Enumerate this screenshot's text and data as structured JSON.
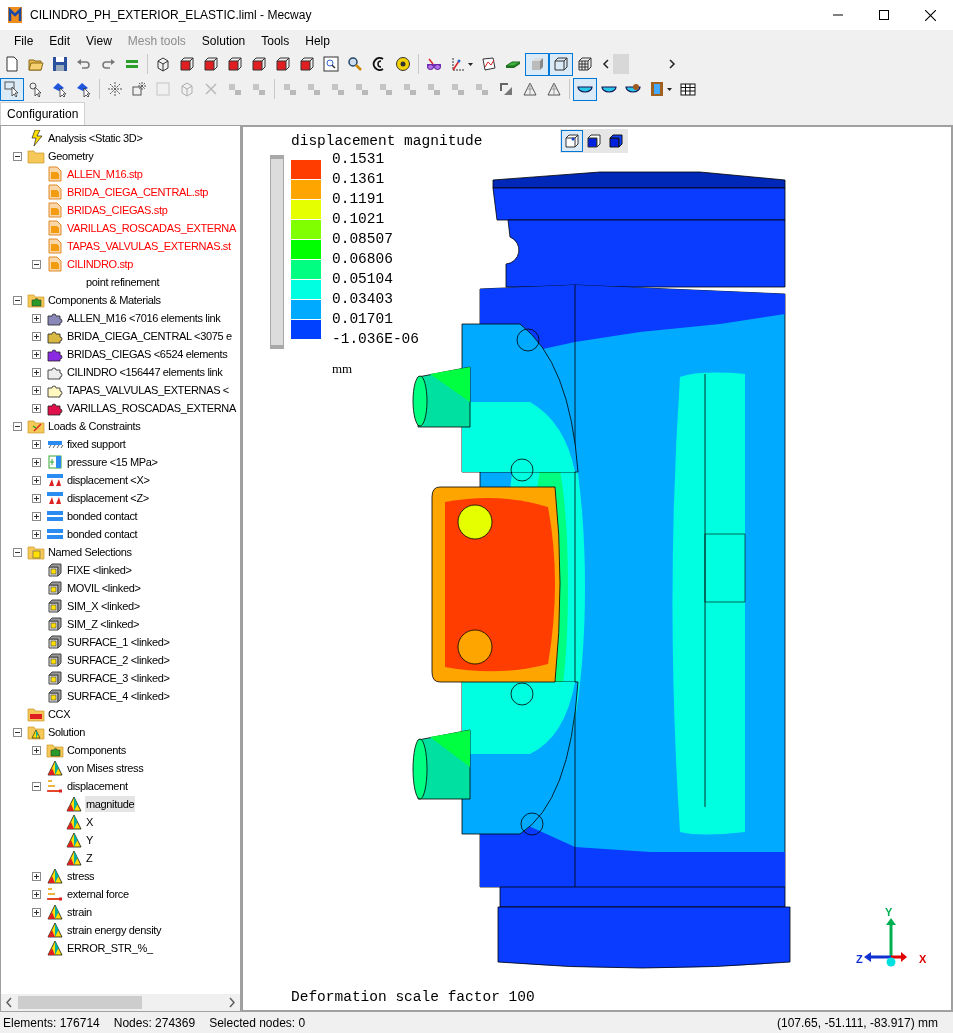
{
  "window": {
    "title": "CILINDRO_PH_EXTERIOR_ELASTIC.liml - Mecway"
  },
  "menu": [
    {
      "label": "File",
      "disabled": false
    },
    {
      "label": "Edit",
      "disabled": false
    },
    {
      "label": "View",
      "disabled": false
    },
    {
      "label": "Mesh tools",
      "disabled": true
    },
    {
      "label": "Solution",
      "disabled": false
    },
    {
      "label": "Tools",
      "disabled": false
    },
    {
      "label": "Help",
      "disabled": false
    }
  ],
  "toolbars": [
    [
      [
        {
          "kind": "page",
          "selected": false,
          "disabled": false,
          "dropdown": false
        },
        {
          "kind": "open",
          "selected": false,
          "disabled": false,
          "dropdown": false
        },
        {
          "kind": "save",
          "selected": false,
          "disabled": false,
          "dropdown": false
        },
        {
          "kind": "undo",
          "selected": false,
          "disabled": false,
          "dropdown": false
        },
        {
          "kind": "redo",
          "selected": false,
          "disabled": false,
          "dropdown": false
        },
        {
          "kind": "equals",
          "selected": false,
          "disabled": false,
          "dropdown": false
        }
      ],
      [
        {
          "kind": "wirecube",
          "selected": false,
          "disabled": false,
          "dropdown": false
        },
        {
          "kind": "redcube",
          "selected": false,
          "disabled": false,
          "dropdown": false
        },
        {
          "kind": "redcube",
          "selected": false,
          "disabled": false,
          "dropdown": false
        },
        {
          "kind": "redcube",
          "selected": false,
          "disabled": false,
          "dropdown": false
        },
        {
          "kind": "redcube",
          "selected": false,
          "disabled": false,
          "dropdown": false
        },
        {
          "kind": "redcube",
          "selected": false,
          "disabled": false,
          "dropdown": false
        },
        {
          "kind": "redcube",
          "selected": false,
          "disabled": false,
          "dropdown": false
        },
        {
          "kind": "zoombox",
          "selected": false,
          "disabled": false,
          "dropdown": false
        },
        {
          "kind": "magnifier",
          "selected": false,
          "disabled": false,
          "dropdown": false
        },
        {
          "kind": "rotate",
          "selected": false,
          "disabled": false,
          "dropdown": false
        },
        {
          "kind": "tape",
          "selected": false,
          "disabled": false,
          "dropdown": false
        }
      ],
      [
        {
          "kind": "glasses",
          "selected": false,
          "disabled": false,
          "dropdown": false
        },
        {
          "kind": "axes",
          "selected": false,
          "disabled": false,
          "dropdown": true
        },
        {
          "kind": "plot",
          "selected": false,
          "disabled": false,
          "dropdown": false
        },
        {
          "kind": "plate",
          "selected": false,
          "disabled": false,
          "dropdown": false
        },
        {
          "kind": "solidcube",
          "selected": true,
          "disabled": false,
          "dropdown": false
        },
        {
          "kind": "boxcube",
          "selected": true,
          "disabled": false,
          "dropdown": false
        },
        {
          "kind": "meshcube",
          "selected": false,
          "disabled": false,
          "dropdown": false
        }
      ]
    ],
    [
      [
        {
          "kind": "select",
          "selected": true,
          "disabled": false,
          "dropdown": false
        },
        {
          "kind": "selectpoint",
          "selected": false,
          "disabled": false,
          "dropdown": false
        },
        {
          "kind": "selectblue",
          "selected": false,
          "disabled": false,
          "dropdown": false
        },
        {
          "kind": "selectblue",
          "selected": false,
          "disabled": false,
          "dropdown": false
        }
      ],
      [
        {
          "kind": "star",
          "selected": false,
          "disabled": false,
          "dropdown": false
        },
        {
          "kind": "starbox",
          "selected": false,
          "disabled": false,
          "dropdown": false
        },
        {
          "kind": "square",
          "selected": false,
          "disabled": true,
          "dropdown": false
        },
        {
          "kind": "wirecube",
          "selected": false,
          "disabled": true,
          "dropdown": false
        },
        {
          "kind": "cross",
          "selected": false,
          "disabled": true,
          "dropdown": false
        },
        {
          "kind": "generic",
          "selected": false,
          "disabled": true,
          "dropdown": false
        },
        {
          "kind": "generic",
          "selected": false,
          "disabled": true,
          "dropdown": false
        }
      ],
      [
        {
          "kind": "generic",
          "selected": false,
          "disabled": true,
          "dropdown": false
        },
        {
          "kind": "generic",
          "selected": false,
          "disabled": true,
          "dropdown": false
        },
        {
          "kind": "generic",
          "selected": false,
          "disabled": true,
          "dropdown": false
        },
        {
          "kind": "generic",
          "selected": false,
          "disabled": true,
          "dropdown": false
        },
        {
          "kind": "generic",
          "selected": false,
          "disabled": true,
          "dropdown": false
        },
        {
          "kind": "generic",
          "selected": false,
          "disabled": true,
          "dropdown": false
        },
        {
          "kind": "generic",
          "selected": false,
          "disabled": true,
          "dropdown": false
        },
        {
          "kind": "generic",
          "selected": false,
          "disabled": true,
          "dropdown": false
        },
        {
          "kind": "generic",
          "selected": false,
          "disabled": true,
          "dropdown": false
        },
        {
          "kind": "corner",
          "selected": false,
          "disabled": false,
          "dropdown": false
        },
        {
          "kind": "triangle",
          "selected": false,
          "disabled": false,
          "dropdown": false
        },
        {
          "kind": "triangle",
          "selected": false,
          "disabled": false,
          "dropdown": false
        }
      ],
      [
        {
          "kind": "bowl",
          "selected": true,
          "disabled": false,
          "dropdown": false
        },
        {
          "kind": "bowl",
          "selected": false,
          "disabled": false,
          "dropdown": false
        },
        {
          "kind": "bowleye",
          "selected": false,
          "disabled": false,
          "dropdown": false
        },
        {
          "kind": "film",
          "selected": false,
          "disabled": false,
          "dropdown": true
        },
        {
          "kind": "table",
          "selected": false,
          "disabled": false,
          "dropdown": false
        }
      ]
    ]
  ],
  "tabs": [
    {
      "label": "Configuration",
      "selected": true
    }
  ],
  "tree": [
    {
      "label": "Analysis <Static 3D>",
      "kind": "analysis",
      "selected": false
    },
    {
      "label": "Geometry",
      "kind": "folder",
      "expanded": true,
      "selected": false,
      "children": [
        {
          "label": "ALLEN_M16.stp",
          "kind": "file",
          "color": "#ff0000",
          "selected": false
        },
        {
          "label": "BRIDA_CIEGA_CENTRAL.stp",
          "kind": "file",
          "color": "#ff0000",
          "selected": false
        },
        {
          "label": "BRIDAS_CIEGAS.stp",
          "kind": "file",
          "color": "#ff0000",
          "selected": false
        },
        {
          "label": "VARILLAS_ROSCADAS_EXTERNA",
          "kind": "file",
          "color": "#ff0000",
          "selected": false
        },
        {
          "label": "TAPAS_VALVULAS_EXTERNAS.st",
          "kind": "file",
          "color": "#ff0000",
          "selected": false
        },
        {
          "label": "CILINDRO.stp",
          "kind": "file",
          "color": "#ff0000",
          "expanded": true,
          "selected": false,
          "children": [
            {
              "label": "point refinement",
              "kind": "plain",
              "selected": false
            }
          ]
        }
      ]
    },
    {
      "label": "Components & Materials",
      "kind": "components-folder",
      "expanded": true,
      "selected": false,
      "children": [
        {
          "label": "ALLEN_M16 <7016 elements link",
          "kind": "component",
          "color": "#8a88b8",
          "expanded": false,
          "selected": false
        },
        {
          "label": "BRIDA_CIEGA_CENTRAL <3075 e",
          "kind": "component",
          "color": "#d8b840",
          "expanded": false,
          "selected": false
        },
        {
          "label": "BRIDAS_CIEGAS <6524 elements",
          "kind": "component",
          "color": "#8a2be2",
          "expanded": false,
          "selected": false
        },
        {
          "label": "CILINDRO <156447 elements link",
          "kind": "component",
          "color": "#ececec",
          "expanded": false,
          "selected": false
        },
        {
          "label": "TAPAS_VALVULAS_EXTERNAS <",
          "kind": "component",
          "color": "#fff8c0",
          "expanded": false,
          "selected": false
        },
        {
          "label": "VARILLAS_ROSCADAS_EXTERNA",
          "kind": "component",
          "color": "#e0104a",
          "expanded": false,
          "selected": false
        }
      ]
    },
    {
      "label": "Loads & Constraints",
      "kind": "loads-folder",
      "expanded": true,
      "selected": false,
      "children": [
        {
          "label": "fixed support",
          "kind": "fixed",
          "expanded": false,
          "selected": false
        },
        {
          "label": "pressure <15 MPa>",
          "kind": "pressure",
          "expanded": false,
          "selected": false
        },
        {
          "label": "displacement <X>",
          "kind": "displacement",
          "expanded": false,
          "selected": false
        },
        {
          "label": "displacement <Z>",
          "kind": "displacement",
          "expanded": false,
          "selected": false
        },
        {
          "label": "bonded contact",
          "kind": "bonded",
          "expanded": false,
          "selected": false
        },
        {
          "label": "bonded contact",
          "kind": "bonded",
          "expanded": false,
          "selected": false
        }
      ]
    },
    {
      "label": "Named Selections",
      "kind": "selections-folder",
      "expanded": true,
      "selected": false,
      "children": [
        {
          "label": "FIXE <linked>",
          "kind": "selection",
          "selected": false
        },
        {
          "label": "MOVIL <linked>",
          "kind": "selection",
          "selected": false
        },
        {
          "label": "SIM_X <linked>",
          "kind": "selection",
          "selected": false
        },
        {
          "label": "SIM_Z <linked>",
          "kind": "selection",
          "selected": false
        },
        {
          "label": "SURFACE_1 <linked>",
          "kind": "selection",
          "selected": false
        },
        {
          "label": "SURFACE_2 <linked>",
          "kind": "selection",
          "selected": false
        },
        {
          "label": "SURFACE_3 <linked>",
          "kind": "selection",
          "selected": false
        },
        {
          "label": "SURFACE_4 <linked>",
          "kind": "selection",
          "selected": false
        }
      ]
    },
    {
      "label": "CCX",
      "kind": "solver-folder",
      "selected": false
    },
    {
      "label": "Solution",
      "kind": "solution-folder",
      "expanded": true,
      "selected": false,
      "children": [
        {
          "label": "Components",
          "kind": "components-folder",
          "expanded": false,
          "selected": false
        },
        {
          "label": "von Mises stress",
          "kind": "result",
          "selected": false
        },
        {
          "label": "displacement",
          "kind": "vector",
          "expanded": true,
          "selected": false,
          "children": [
            {
              "label": "magnitude",
              "kind": "result",
              "selected": true
            },
            {
              "label": "X",
              "kind": "result",
              "selected": false
            },
            {
              "label": "Y",
              "kind": "result",
              "selected": false
            },
            {
              "label": "Z",
              "kind": "result",
              "selected": false
            }
          ]
        },
        {
          "label": "stress",
          "kind": "result",
          "expanded": false,
          "selected": false
        },
        {
          "label": "external force",
          "kind": "vector",
          "expanded": false,
          "selected": false
        },
        {
          "label": "strain",
          "kind": "result",
          "expanded": false,
          "selected": false
        },
        {
          "label": "strain energy density",
          "kind": "result",
          "selected": false
        },
        {
          "label": "ERROR_STR_%_",
          "kind": "result",
          "selected": false
        }
      ]
    }
  ],
  "view_modes": [
    {
      "kind": "wireframe",
      "selected": true
    },
    {
      "kind": "solid-edges",
      "selected": false
    },
    {
      "kind": "solid",
      "selected": false
    }
  ],
  "legend": {
    "title": "displacement magnitude",
    "swatches": [
      {
        "color": "#ff3d00"
      },
      {
        "color": "#ffa500"
      },
      {
        "color": "#e6ff00"
      },
      {
        "color": "#80ff00"
      },
      {
        "color": "#00ff00"
      },
      {
        "color": "#00ff80"
      },
      {
        "color": "#00ffe0"
      },
      {
        "color": "#00aaff"
      },
      {
        "color": "#0040ff"
      }
    ],
    "labels": [
      "0.1531",
      "0.1361",
      "0.1191",
      "0.1021",
      "0.08507",
      "0.06806",
      "0.05104",
      "0.03403",
      "0.01701",
      "-1.036E-06"
    ],
    "unit": "mm",
    "slider": {
      "level": 1
    }
  },
  "deformation_note": "Deformation scale factor 100",
  "axes": {
    "y": "Y",
    "z": "Z",
    "x": "X"
  },
  "status_bar": [
    "Elements: 176714",
    "Nodes: 274369",
    "Selected nodes: 0",
    "(107.65, -51.111, -83.917) mm"
  ]
}
